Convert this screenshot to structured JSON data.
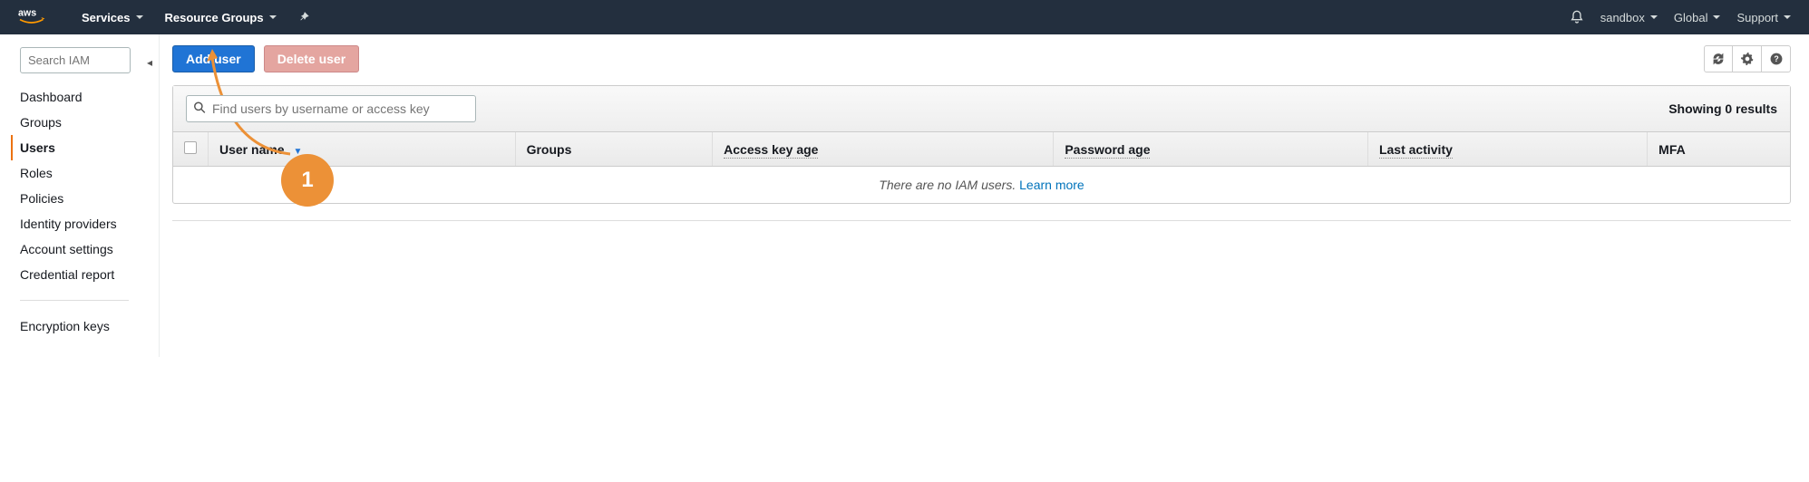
{
  "topnav": {
    "services": "Services",
    "resource_groups": "Resource Groups"
  },
  "topright": {
    "account": "sandbox",
    "region": "Global",
    "support": "Support"
  },
  "sidebar": {
    "search_placeholder": "Search IAM",
    "items": [
      {
        "label": "Dashboard",
        "active": false
      },
      {
        "label": "Groups",
        "active": false
      },
      {
        "label": "Users",
        "active": true
      },
      {
        "label": "Roles",
        "active": false
      },
      {
        "label": "Policies",
        "active": false
      },
      {
        "label": "Identity providers",
        "active": false
      },
      {
        "label": "Account settings",
        "active": false
      },
      {
        "label": "Credential report",
        "active": false
      }
    ],
    "bottom_items": [
      {
        "label": "Encryption keys"
      }
    ]
  },
  "toolbar": {
    "add_user": "Add user",
    "delete_user": "Delete user"
  },
  "panel": {
    "filter_placeholder": "Find users by username or access key",
    "results_text": "Showing 0 results"
  },
  "table": {
    "columns": {
      "username": "User name",
      "groups": "Groups",
      "access_key_age": "Access key age",
      "password_age": "Password age",
      "last_activity": "Last activity",
      "mfa": "MFA"
    },
    "empty_text": "There are no IAM users. ",
    "learn_more": "Learn more"
  },
  "annotation": {
    "number": "1"
  }
}
